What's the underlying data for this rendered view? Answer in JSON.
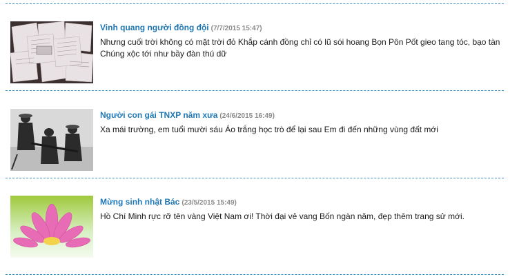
{
  "articles": [
    {
      "title": "Vinh quang người đồng đội",
      "date": "(7/7/2015 15:47)",
      "summary_lines": [
        "Nhưng cuối trời không có mặt trời đỏ Khắp cánh đồng chỉ có lũ sói hoang Bọn Pôn Pốt gieo tang tóc, bạo tàn",
        "Chúng xộc tới như bầy đàn thú dữ"
      ],
      "thumbnail_icon": "letters-photo-icon"
    },
    {
      "title": "Người con gái TNXP năm xưa",
      "date": "(24/6/2015 16:49)",
      "summary_lines": [
        "Xa mái trường, em tuổi mười sáu Áo trắng học trò để lại sau Em đi đến những vùng đất mới"
      ],
      "thumbnail_icon": "youth-volunteers-photo-icon"
    },
    {
      "title": "Mừng sinh nhật Bác",
      "date": "(23/5/2015 15:49)",
      "summary_lines": [
        "Hồ Chí Minh rực rỡ tên vàng Việt Nam ơi! Thời đại vẻ vang Bốn ngàn năm, đẹp thêm trang sử mới."
      ],
      "thumbnail_icon": "lotus-flower-photo-icon"
    }
  ],
  "colors": {
    "title": "#1f78b4",
    "date": "#8a8a8a",
    "separator": "#3a8fc0"
  }
}
